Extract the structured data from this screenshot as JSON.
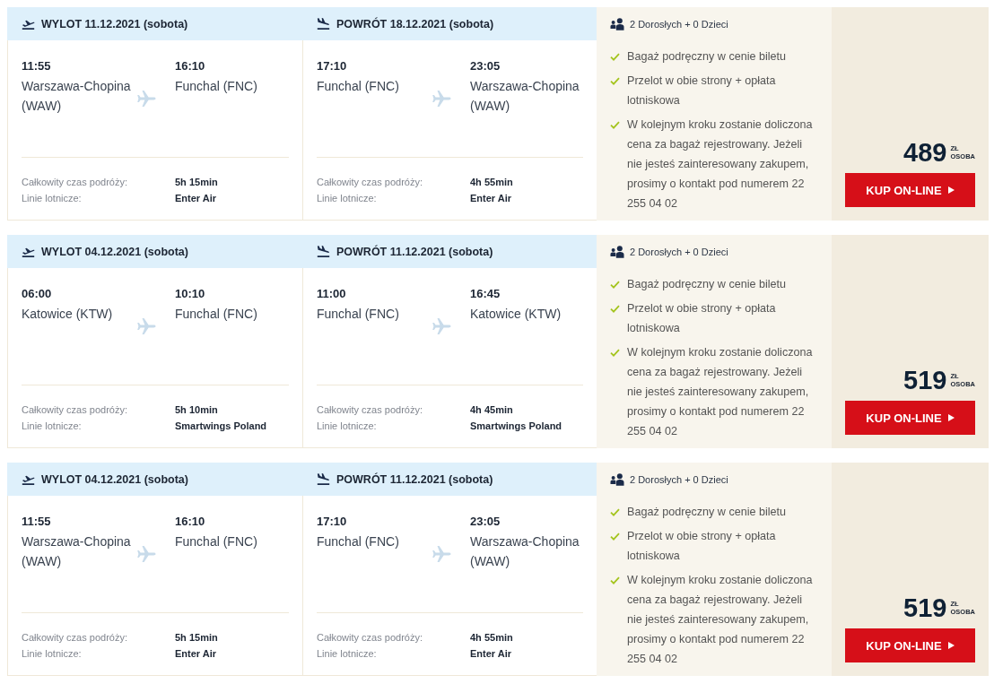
{
  "offers": [
    {
      "legs": [
        {
          "kind": "departure",
          "title": "WYLOT 11.12.2021 (sobota)",
          "from": {
            "time": "11:55",
            "airport": "Warszawa-Chopina (WAW)"
          },
          "to": {
            "time": "16:10",
            "airport": "Funchal (FNC)"
          },
          "details": [
            {
              "label": "Całkowity czas podróży:",
              "value": "5h 15min"
            },
            {
              "label": "Linie lotnicze:",
              "value": "Enter Air"
            }
          ]
        },
        {
          "kind": "return",
          "title": "POWRÓT 18.12.2021 (sobota)",
          "from": {
            "time": "17:10",
            "airport": "Funchal (FNC)"
          },
          "to": {
            "time": "23:05",
            "airport": "Warszawa-Chopina (WAW)"
          },
          "details": [
            {
              "label": "Całkowity czas podróży:",
              "value": "4h 55min"
            },
            {
              "label": "Linie lotnicze:",
              "value": "Enter Air"
            }
          ]
        }
      ],
      "passengers": "2 Dorosłych + 0 Dzieci",
      "features": [
        "Bagaż podręczny w cenie biletu",
        "Przelot w obie strony + opłata lotniskowa",
        "W kolejnym kroku zostanie doliczona cena za bagaż rejestrowany. Jeżeli nie jesteś zainteresowany zakupem, prosimy o kontakt pod numerem 22 255 04 02"
      ],
      "price": "489",
      "currency": "ZŁ",
      "per": "OSOBA",
      "button": "KUP ON-LINE"
    },
    {
      "legs": [
        {
          "kind": "departure",
          "title": "WYLOT 04.12.2021 (sobota)",
          "from": {
            "time": "06:00",
            "airport": "Katowice (KTW)"
          },
          "to": {
            "time": "10:10",
            "airport": "Funchal (FNC)"
          },
          "details": [
            {
              "label": "Całkowity czas podróży:",
              "value": "5h 10min"
            },
            {
              "label": "Linie lotnicze:",
              "value": "Smartwings Poland"
            }
          ]
        },
        {
          "kind": "return",
          "title": "POWRÓT 11.12.2021 (sobota)",
          "from": {
            "time": "11:00",
            "airport": "Funchal (FNC)"
          },
          "to": {
            "time": "16:45",
            "airport": "Katowice (KTW)"
          },
          "details": [
            {
              "label": "Całkowity czas podróży:",
              "value": "4h 45min"
            },
            {
              "label": "Linie lotnicze:",
              "value": "Smartwings Poland"
            }
          ]
        }
      ],
      "passengers": "2 Dorosłych + 0 Dzieci",
      "features": [
        "Bagaż podręczny w cenie biletu",
        "Przelot w obie strony + opłata lotniskowa",
        "W kolejnym kroku zostanie doliczona cena za bagaż rejestrowany. Jeżeli nie jesteś zainteresowany zakupem, prosimy o kontakt pod numerem 22 255 04 02"
      ],
      "price": "519",
      "currency": "ZŁ",
      "per": "OSOBA",
      "button": "KUP ON-LINE"
    },
    {
      "legs": [
        {
          "kind": "departure",
          "title": "WYLOT 04.12.2021 (sobota)",
          "from": {
            "time": "11:55",
            "airport": "Warszawa-Chopina (WAW)"
          },
          "to": {
            "time": "16:10",
            "airport": "Funchal (FNC)"
          },
          "details": [
            {
              "label": "Całkowity czas podróży:",
              "value": "5h 15min"
            },
            {
              "label": "Linie lotnicze:",
              "value": "Enter Air"
            }
          ]
        },
        {
          "kind": "return",
          "title": "POWRÓT 11.12.2021 (sobota)",
          "from": {
            "time": "17:10",
            "airport": "Funchal (FNC)"
          },
          "to": {
            "time": "23:05",
            "airport": "Warszawa-Chopina (WAW)"
          },
          "details": [
            {
              "label": "Całkowity czas podróży:",
              "value": "4h 55min"
            },
            {
              "label": "Linie lotnicze:",
              "value": "Enter Air"
            }
          ]
        }
      ],
      "passengers": "2 Dorosłych + 0 Dzieci",
      "features": [
        "Bagaż podręczny w cenie biletu",
        "Przelot w obie strony + opłata lotniskowa",
        "W kolejnym kroku zostanie doliczona cena za bagaż rejestrowany. Jeżeli nie jesteś zainteresowany zakupem, prosimy o kontakt pod numerem 22 255 04 02"
      ],
      "price": "519",
      "currency": "ZŁ",
      "per": "OSOBA",
      "button": "KUP ON-LINE"
    }
  ]
}
